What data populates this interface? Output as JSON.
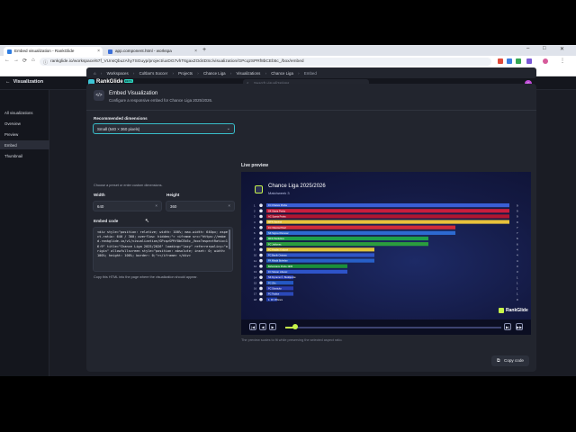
{
  "browser": {
    "tabs": [
      {
        "title": "Embed visualization - RankGlide"
      },
      {
        "title": "app.component.html - workspa"
      }
    ],
    "new_tab_label": "+",
    "window_controls": [
      "–",
      "□",
      "✕"
    ],
    "url": "rankglide.io/workspace/67f_VUnsQbuzAhy7SGuyp/project/uxDG7vhT6gaxZOd4DSc/visualization/GPcqzSPRf8bCEb5c_/box/embed",
    "nav": {
      "back": "←",
      "forward": "→",
      "reload": "⟳",
      "home": "⌂"
    },
    "bookmarks": [
      {
        "label": "My Projects",
        "folder": false
      },
      {
        "label": "CDCX",
        "folder": false
      },
      {
        "label": "WG",
        "folder": false
      },
      {
        "label": "Angular",
        "folder": false
      },
      {
        "label": "Best Pages",
        "folder": true
      },
      {
        "label": "Other",
        "folder": true
      },
      {
        "label": "Shipd",
        "folder": false
      }
    ]
  },
  "app": {
    "section_title": "Visualization",
    "back_arrow": "←",
    "brand": "RankGlide",
    "brand_badge": "BETA",
    "search_placeholder": "Search visualizations...",
    "avatar_initial": "C",
    "sidebar": [
      {
        "label": "All visualizations",
        "active": false
      },
      {
        "label": "Overview",
        "active": false
      },
      {
        "label": "Preview",
        "active": false
      },
      {
        "label": "Embed",
        "active": true
      },
      {
        "label": "Thumbnail",
        "active": false
      }
    ],
    "breadcrumb": {
      "home_icon": "⌂",
      "items": [
        "Workspaces",
        "Coltlan's Soccer",
        "Projects",
        "Chance Liga",
        "Visualizations",
        "Chance Liga",
        "Embed"
      ],
      "separator": "›"
    }
  },
  "embed": {
    "icon": "</>",
    "title": "Embed Visualization",
    "subtitle": "Configure a responsive embed for Chance Liga 2025/2026.",
    "dimensions_label": "Recommended dimensions",
    "dimensions_value": "Small (640 × 360 pixels)",
    "dimensions_help": "Choose a preset or enter custom dimensions.",
    "width_label": "Width",
    "width_value": "640",
    "height_label": "Height",
    "height_value": "360",
    "clear_icon": "×",
    "code_label": "Embed code",
    "code": "<div style=\"position: relative; width: 100%; max-width: 640px; aspect-ratio: 640 / 360; overflow: hidden;\">\n  <iframe\n    src=\"https://embed.rankglide.io/v1/visualization/GPcqzSPRf8bCEb5c_/box?aspectRatio=16:9\" title=\"Chance Liga 2025/2026\" loading=\"lazy\" referrerpolicy=\"origin\" allowfullscreen style=\"position: absolute; inset: 0; width: 100%; height: 100%; border: 0;\"></iframe>\n</div>",
    "code_help": "Copy this HTML into the page where the visualization should appear.",
    "live_label": "Live preview",
    "scale_note": "The preview scales to fit while preserving the selected aspect ratio.",
    "copy_label": "Copy code",
    "copy_icon": "⧉"
  },
  "preview": {
    "title": "Chance Liga 2025/2026",
    "subtitle": "Matchweek 3",
    "brand": "RankGlide",
    "controls": {
      "first": "|◀",
      "prev": "◀",
      "play": "▶",
      "next": "▶|",
      "last": "▶▶"
    },
    "progress": 0.05,
    "colors": {
      "lime": "#c7f54a",
      "bg": "#141a44"
    }
  },
  "chart_data": {
    "type": "bar",
    "title": "Chance Liga 2025/2026",
    "subtitle": "Matchweek 3",
    "orientation": "horizontal",
    "categories": [
      "FC Chance Praha",
      "SK Slavia Praha",
      "AC Sparta Praha",
      "MFK Karviná",
      "FC Viktoria Plzeň",
      "SK Sigma Olomouc",
      "MFK Pardubice",
      "FC Jablonec",
      "FC Hradec Králové",
      "FC Baník Ostrava",
      "FK Mladá Boleslav",
      "Bohemians Praha 1905",
      "FC Slovan Liberec",
      "SK Dynamo Č. Budějovice",
      "FC Zlín",
      "FC Slovácko",
      "FC Teplice",
      "1. FK Příbram"
    ],
    "values": [
      9,
      9,
      9,
      9,
      7,
      7,
      6,
      6,
      4,
      4,
      4,
      3,
      3,
      1,
      1,
      1,
      1,
      0
    ],
    "ranks": [
      "1",
      "2",
      "3",
      "4",
      "5",
      "6",
      "7",
      "8",
      "9",
      "10",
      "11",
      "12",
      "13",
      "14",
      "15",
      "16",
      "17",
      "18"
    ],
    "bar_colors": [
      "#3a5fd6",
      "#c91e3d",
      "#b01631",
      "#e8c23b",
      "#d02b3a",
      "#2d6ad1",
      "#1fa04a",
      "#2b9d3e",
      "#e0c33a",
      "#2f55c7",
      "#2760c8",
      "#1b8f3a",
      "#2e54c9",
      "#2a3fb4",
      "#2458c4",
      "#2a3db0",
      "#2b49b8",
      "#1e3aa8"
    ],
    "xlim": [
      0,
      9
    ]
  }
}
